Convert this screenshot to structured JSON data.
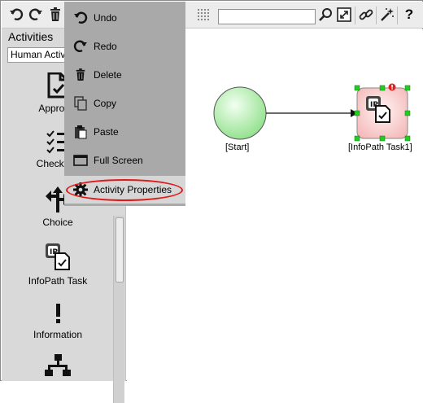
{
  "toolbar": {
    "icons": [
      "undo-icon",
      "redo-icon",
      "trash-icon",
      "grid-icon",
      "zoom-icon",
      "fit-icon",
      "link-icon",
      "magic-wand-icon",
      "help-icon"
    ],
    "search_value": "",
    "help_glyph": "?"
  },
  "sidebar": {
    "title": "Activities",
    "category_selected": "Human Activities",
    "items": [
      {
        "label": "Approval",
        "icon": "approval-icon"
      },
      {
        "label": "Check-list",
        "icon": "checklist-icon"
      },
      {
        "label": "Choice",
        "icon": "choice-icon"
      },
      {
        "label": "InfoPath Task",
        "icon": "infopath-icon"
      },
      {
        "label": "Information",
        "icon": "information-icon"
      },
      {
        "label": "",
        "icon": "hierarchy-icon"
      }
    ]
  },
  "context_menu": {
    "items": [
      {
        "label": "Undo",
        "icon": "undo-icon"
      },
      {
        "label": "Redo",
        "icon": "redo-icon"
      },
      {
        "label": "Delete",
        "icon": "trash-icon"
      },
      {
        "label": "Copy",
        "icon": "copy-icon"
      },
      {
        "label": "Paste",
        "icon": "paste-icon"
      },
      {
        "label": "Full Screen",
        "icon": "fullscreen-icon"
      },
      {
        "label": "Activity Properties",
        "icon": "gear-icon",
        "highlighted": true
      }
    ]
  },
  "diagram": {
    "start_label": "[Start]",
    "task_label": "[InfoPath Task1]",
    "colors": {
      "start_fill": "#c9f5c4",
      "task_fill": "#f8cece",
      "handle": "#22cc22",
      "warning": "#dd2222",
      "highlight": "#e01818"
    }
  }
}
